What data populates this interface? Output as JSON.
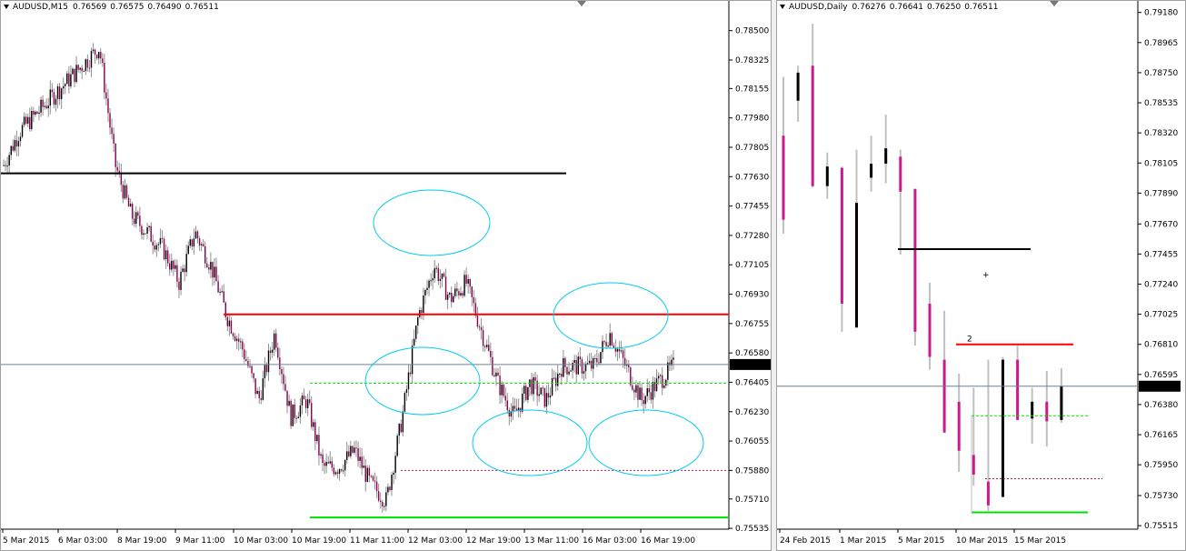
{
  "left": {
    "symbol": "AUDUSD,M15",
    "quotes": [
      "0.76569",
      "0.76575",
      "0.76490",
      "0.76511"
    ],
    "price_labels": [
      "0.78500",
      "0.78325",
      "0.78155",
      "0.77980",
      "0.77805",
      "0.77630",
      "0.77455",
      "0.77280",
      "0.77105",
      "0.76930",
      "0.76755",
      "0.76580",
      "0.76405",
      "0.76230",
      "0.76055",
      "0.75880",
      "0.75710",
      "0.75535"
    ],
    "time_labels": [
      "5 Mar 2015",
      "6 Mar 03:00",
      "8 Mar 19:00",
      "9 Mar 11:00",
      "10 Mar 03:00",
      "10 Mar 19:00",
      "11 Mar 11:00",
      "12 Mar 03:00",
      "12 Mar 19:00",
      "13 Mar 11:00",
      "16 Mar 03:00",
      "16 Mar 19:00"
    ],
    "current_price": "0.76511",
    "colors": {
      "black_level": "#000000",
      "red_level": "#ff0000",
      "green_level": "#00e000",
      "ellipse": "#00ccee",
      "candle": "#8b0050",
      "wick": "#909090"
    }
  },
  "right": {
    "symbol": "AUDUSD,Daily",
    "quotes": [
      "0.76276",
      "0.76641",
      "0.76250",
      "0.76511"
    ],
    "price_labels": [
      "0.79180",
      "0.78965",
      "0.78750",
      "0.78535",
      "0.78320",
      "0.78105",
      "0.77890",
      "0.77670",
      "0.77455",
      "0.77240",
      "0.77025",
      "0.76810",
      "0.76595",
      "0.76380",
      "0.76165",
      "0.75950",
      "0.75730",
      "0.75515"
    ],
    "time_labels": [
      "24 Feb 2015",
      "1 Mar 2015",
      "5 Mar 2015",
      "10 Mar 2015",
      "15 Mar 2015"
    ],
    "current_price": "0.76511",
    "annotation_number": "2",
    "annotation_cross": "+",
    "colors": {
      "bull": "#000000",
      "bear": "#cc1a8c",
      "wick": "#c0c0c0",
      "red_level": "#ff0000",
      "green_level": "#00e000",
      "black_level": "#000000"
    }
  },
  "chart_data": [
    {
      "type": "candlestick",
      "title": "AUDUSD,M15",
      "ylim": [
        0.7553,
        0.7865
      ],
      "y_ticks": [
        0.785,
        0.78325,
        0.78155,
        0.7798,
        0.77805,
        0.7763,
        0.77455,
        0.7728,
        0.77105,
        0.7693,
        0.76755,
        0.7658,
        0.76405,
        0.7623,
        0.76055,
        0.7588,
        0.7571,
        0.75535
      ],
      "x_labels": [
        "5 Mar 2015",
        "6 Mar 03:00",
        "8 Mar 19:00",
        "9 Mar 11:00",
        "10 Mar 03:00",
        "10 Mar 19:00",
        "11 Mar 11:00",
        "12 Mar 03:00",
        "12 Mar 19:00",
        "13 Mar 11:00",
        "16 Mar 03:00",
        "16 Mar 19:00"
      ],
      "close_path_approx": [
        0.777,
        0.779,
        0.78,
        0.781,
        0.782,
        0.783,
        0.784,
        0.777,
        0.774,
        0.773,
        0.772,
        0.77,
        0.773,
        0.771,
        0.768,
        0.766,
        0.763,
        0.767,
        0.762,
        0.763,
        0.759,
        0.759,
        0.76,
        0.758,
        0.757,
        0.762,
        0.768,
        0.771,
        0.769,
        0.77,
        0.767,
        0.764,
        0.762,
        0.764,
        0.763,
        0.765,
        0.765,
        0.765,
        0.767,
        0.765,
        0.763,
        0.764,
        0.765
      ],
      "horizontal_levels": [
        0.7765,
        0.7681,
        0.764,
        0.7588,
        0.756
      ],
      "last_price": 0.76511
    },
    {
      "type": "candlestick",
      "title": "AUDUSD,Daily",
      "ylim": [
        0.7549,
        0.7923
      ],
      "y_ticks": [
        0.7918,
        0.78965,
        0.7875,
        0.78535,
        0.7832,
        0.78105,
        0.7789,
        0.7767,
        0.77455,
        0.7724,
        0.77025,
        0.7681,
        0.76595,
        0.7638,
        0.76165,
        0.7595,
        0.7573,
        0.75515
      ],
      "x_labels": [
        "24 Feb 2015",
        "1 Mar 2015",
        "5 Mar 2015",
        "10 Mar 2015",
        "15 Mar 2015"
      ],
      "ohlc": [
        [
          0.783,
          0.7872,
          0.776,
          0.777
        ],
        [
          0.7855,
          0.788,
          0.784,
          0.7875
        ],
        [
          0.788,
          0.791,
          0.7793,
          0.7794
        ],
        [
          0.7794,
          0.7818,
          0.7785,
          0.7808
        ],
        [
          0.7807,
          0.7808,
          0.769,
          0.771
        ],
        [
          0.7693,
          0.782,
          0.773,
          0.7782
        ],
        [
          0.78,
          0.783,
          0.779,
          0.781
        ],
        [
          0.781,
          0.7845,
          0.7796,
          0.7821
        ],
        [
          0.7815,
          0.782,
          0.7745,
          0.779
        ],
        [
          0.7792,
          0.7762,
          0.768,
          0.769
        ],
        [
          0.771,
          0.7725,
          0.7663,
          0.7672
        ],
        [
          0.767,
          0.7705,
          0.762,
          0.7618
        ],
        [
          0.764,
          0.766,
          0.759,
          0.7605
        ],
        [
          0.7602,
          0.765,
          0.758,
          0.7588
        ],
        [
          0.7583,
          0.767,
          0.7562,
          0.7566
        ],
        [
          0.7572,
          0.7672,
          0.7583,
          0.767
        ],
        [
          0.767,
          0.768,
          0.763,
          0.7627
        ],
        [
          0.7628,
          0.765,
          0.761,
          0.764
        ],
        [
          0.764,
          0.7662,
          0.7608,
          0.7626
        ],
        [
          0.7627,
          0.7664,
          0.7625,
          0.7651
        ]
      ],
      "horizontal_levels": [
        0.7749,
        0.7681,
        0.763,
        0.7585,
        0.7561
      ],
      "last_price": 0.76511
    }
  ]
}
